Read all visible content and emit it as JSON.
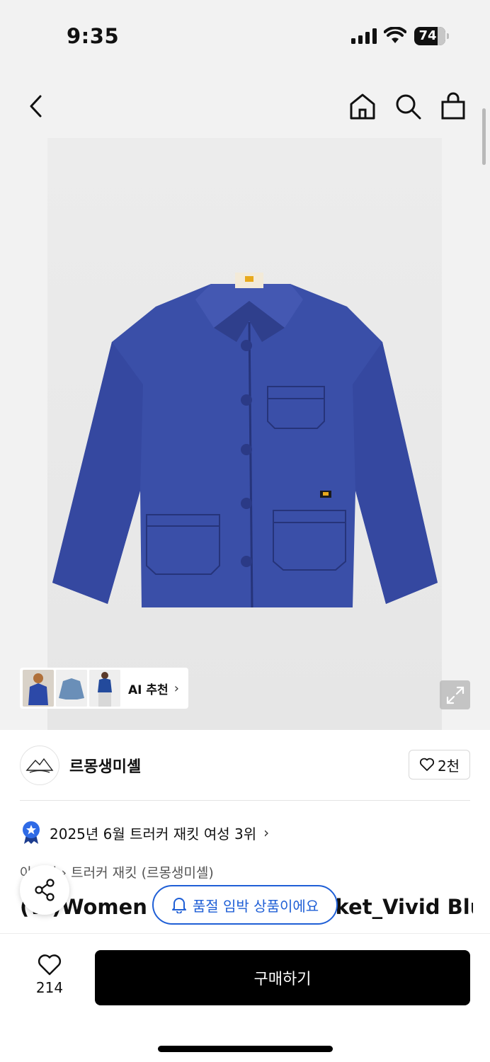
{
  "status_bar": {
    "time": "9:35",
    "battery": "74",
    "icons": [
      "cellular-signal-icon",
      "wifi-icon",
      "battery-icon"
    ]
  },
  "nav": {
    "icons": [
      "back-arrow-icon",
      "home-icon",
      "search-icon",
      "shopping-bag-icon"
    ]
  },
  "gallery": {
    "ai_recommend_label": "AI 추천",
    "ai_chevron": "›",
    "thumbnail_count": 3
  },
  "brand": {
    "name": "르몽생미셸",
    "like_count": "2천"
  },
  "ranking": {
    "text": "2025년 6월 트러커 재킷 여성 3위",
    "chevron": "›"
  },
  "product": {
    "breadcrumb": "아우터 › 트러커 재킷 (르몽생미셸)",
    "title": "(W)Women classic work jacket_Vivid Blue"
  },
  "floating": {
    "soldout_notice": "품절 임박 상품이에요"
  },
  "bottom_bar": {
    "like_count": "214",
    "buy_label": "구매하기"
  },
  "colors": {
    "accent_blue": "#1f5fd6",
    "jacket_blue": "#3a4fa8",
    "buy_button": "#000000",
    "rank_badge": "#2f6be6"
  }
}
